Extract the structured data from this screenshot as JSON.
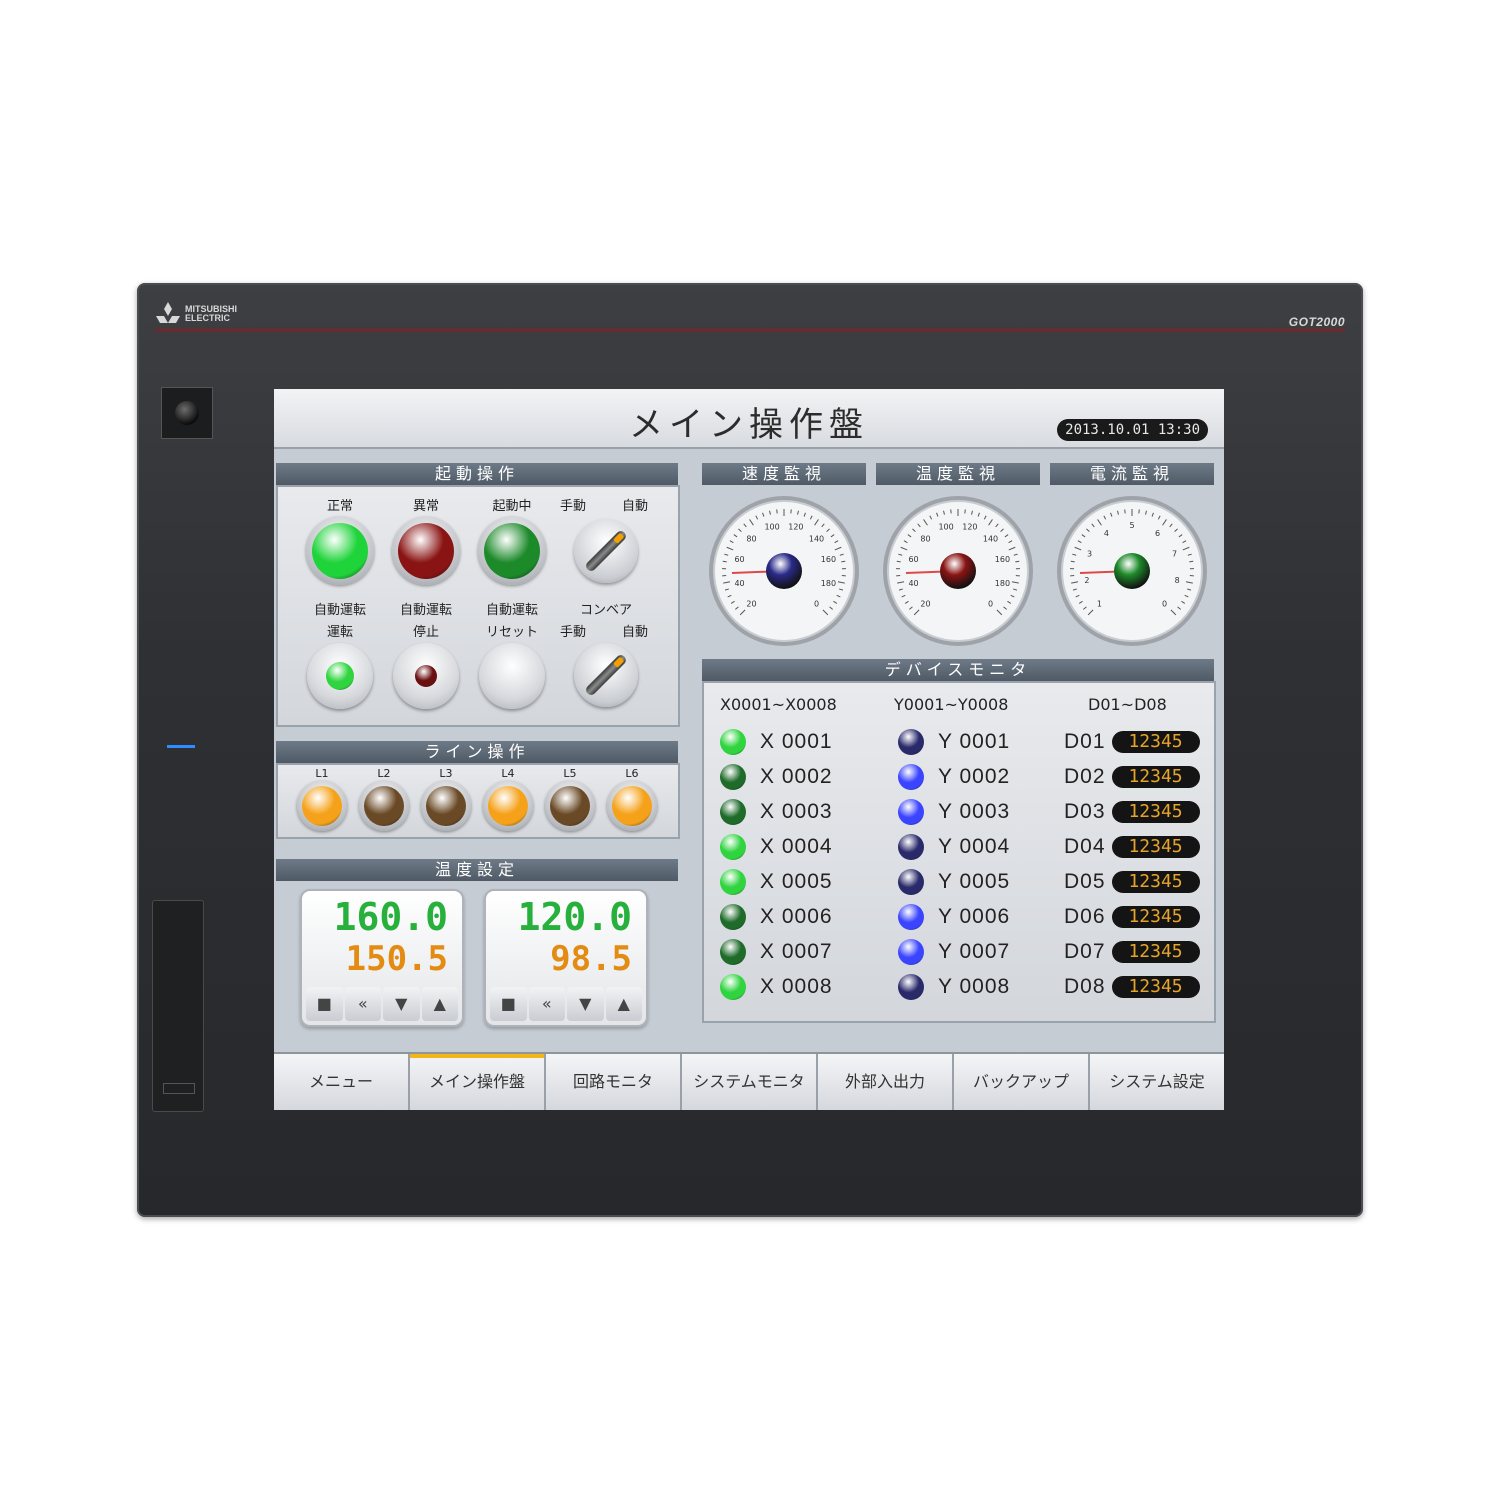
{
  "device": {
    "brand_line1": "MITSUBISHI",
    "brand_line2": "ELECTRIC",
    "model": "GOT2000"
  },
  "screen": {
    "title": "メイン操作盤",
    "datetime": "2013.10.01 13:30",
    "sections": {
      "start_ops": "起動操作",
      "line_ops": "ライン操作",
      "temp_set": "温度設定",
      "speed_mon": "速度監視",
      "temp_mon": "温度監視",
      "current_mon": "電流監視",
      "device_mon": "デバイスモニタ"
    },
    "start_ops": {
      "row1": [
        {
          "label": "正常",
          "color": "#1fd43a"
        },
        {
          "label": "異常",
          "color": "#8a1414"
        },
        {
          "label": "起動中",
          "color": "#1d8a2a"
        }
      ],
      "selector1": {
        "left": "手動",
        "right": "自動"
      },
      "row2_line1": [
        "自動運転",
        "自動運転",
        "自動運転",
        "コンベア"
      ],
      "row2_line2": [
        "運転",
        "停止",
        "リセット"
      ],
      "selector2": {
        "left": "手動",
        "right": "自動"
      }
    },
    "line_ops": {
      "lamps": [
        {
          "label": "L1",
          "state": "on"
        },
        {
          "label": "L2",
          "state": "off"
        },
        {
          "label": "L3",
          "state": "off"
        },
        {
          "label": "L4",
          "state": "on"
        },
        {
          "label": "L5",
          "state": "off"
        },
        {
          "label": "L6",
          "state": "on"
        }
      ],
      "on_color": "#f5a21a",
      "off_color": "#6a4a26"
    },
    "temp_set": {
      "boxes": [
        {
          "sv": "160.0",
          "pv": "150.5"
        },
        {
          "sv": "120.0",
          "pv": "98.5"
        }
      ],
      "buttons": [
        "■",
        "«",
        "▼",
        "▲"
      ]
    },
    "gauges": [
      {
        "ticks": [
          "20",
          "40",
          "60",
          "80",
          "100",
          "120",
          "140",
          "160",
          "180",
          "0"
        ],
        "center_color": "#2a2a8a"
      },
      {
        "ticks": [
          "20",
          "40",
          "60",
          "80",
          "100",
          "120",
          "140",
          "160",
          "180",
          "0"
        ],
        "center_color": "#8a1414"
      },
      {
        "ticks": [
          "1",
          "2",
          "3",
          "4",
          "5",
          "6",
          "7",
          "8",
          "0"
        ],
        "center_color": "#1d8a2a"
      }
    ],
    "device_monitor": {
      "col_x": "X0001~X0008",
      "col_y": "Y0001~Y0008",
      "col_d": "D01~D08",
      "x": [
        {
          "label": "X 0001",
          "on": true
        },
        {
          "label": "X 0002",
          "on": false
        },
        {
          "label": "X 0003",
          "on": false
        },
        {
          "label": "X 0004",
          "on": true
        },
        {
          "label": "X 0005",
          "on": true
        },
        {
          "label": "X 0006",
          "on": false
        },
        {
          "label": "X 0007",
          "on": false
        },
        {
          "label": "X 0008",
          "on": true
        }
      ],
      "y": [
        {
          "label": "Y 0001",
          "on": false
        },
        {
          "label": "Y 0002",
          "on": true
        },
        {
          "label": "Y 0003",
          "on": true
        },
        {
          "label": "Y 0004",
          "on": false
        },
        {
          "label": "Y 0005",
          "on": false
        },
        {
          "label": "Y 0006",
          "on": true
        },
        {
          "label": "Y 0007",
          "on": true
        },
        {
          "label": "Y 0008",
          "on": false
        }
      ],
      "d": [
        {
          "label": "D01",
          "value": "12345"
        },
        {
          "label": "D02",
          "value": "12345"
        },
        {
          "label": "D03",
          "value": "12345"
        },
        {
          "label": "D04",
          "value": "12345"
        },
        {
          "label": "D05",
          "value": "12345"
        },
        {
          "label": "D06",
          "value": "12345"
        },
        {
          "label": "D07",
          "value": "12345"
        },
        {
          "label": "D08",
          "value": "12345"
        }
      ],
      "x_on_color": "#2fd43f",
      "x_off_color": "#1e6b2a",
      "y_on_color": "#3b45ff",
      "y_off_color": "#2a2a6b"
    },
    "tabs": [
      {
        "label": "メニュー",
        "active": false
      },
      {
        "label": "メイン操作盤",
        "active": true
      },
      {
        "label": "回路モニタ",
        "active": false
      },
      {
        "label": "システムモニタ",
        "active": false
      },
      {
        "label": "外部入出力",
        "active": false
      },
      {
        "label": "バックアップ",
        "active": false
      },
      {
        "label": "システム設定",
        "active": false
      }
    ]
  }
}
